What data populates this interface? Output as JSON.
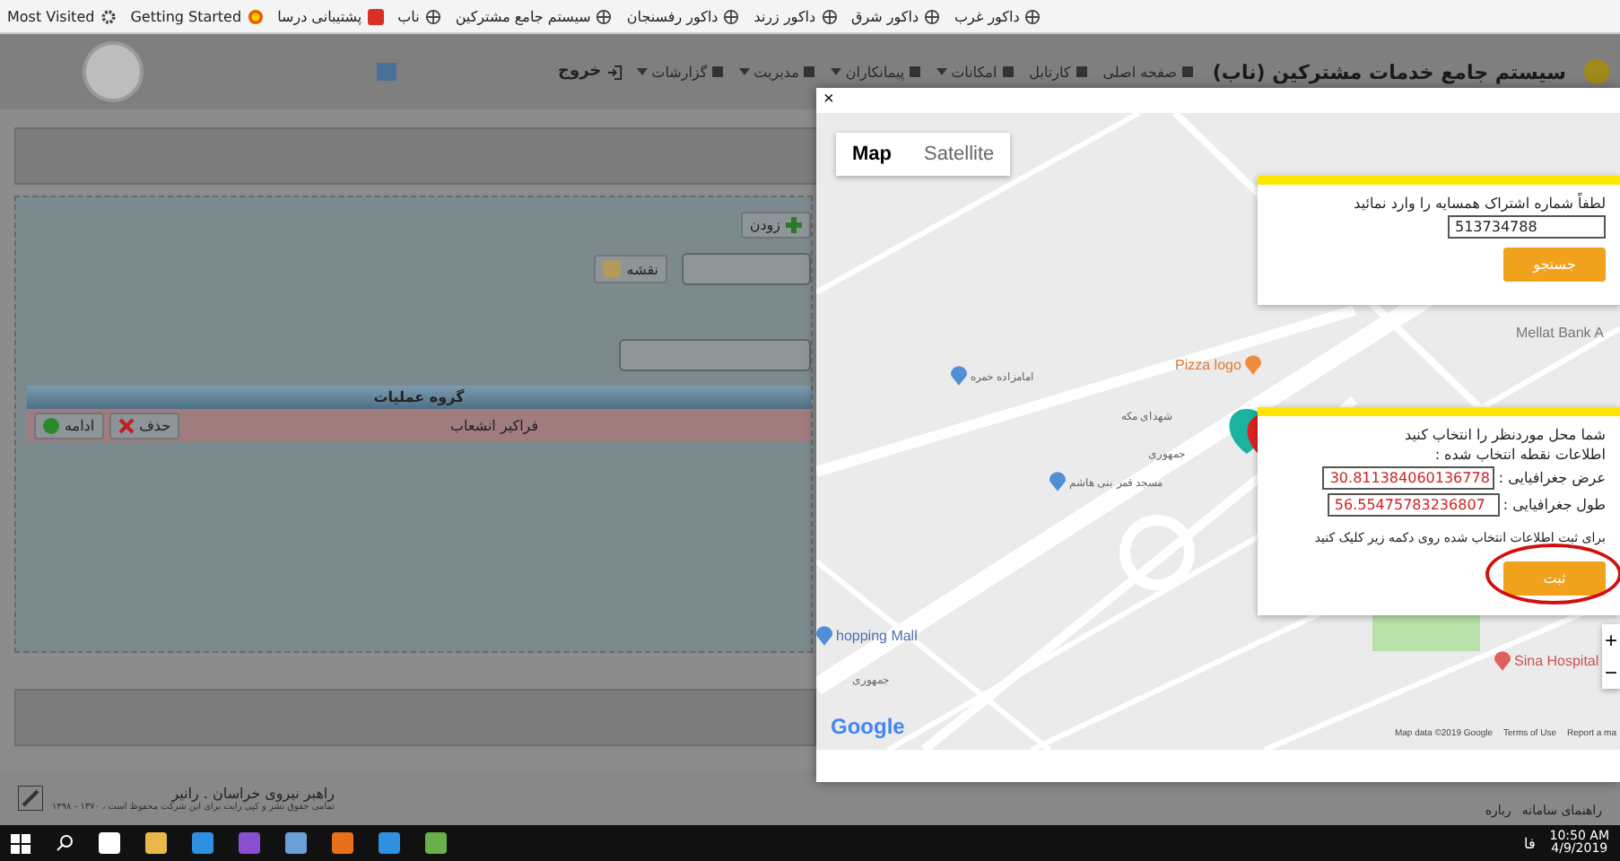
{
  "bookmarks": [
    {
      "label": "داکور غرب",
      "kind": "globe"
    },
    {
      "label": "داکور شرق",
      "kind": "globe"
    },
    {
      "label": "داکور زرند",
      "kind": "globe"
    },
    {
      "label": "داکور رفسنجان",
      "kind": "globe"
    },
    {
      "label": "سیستم جامع مشترکین",
      "kind": "globe"
    },
    {
      "label": "ناب",
      "kind": "globe"
    },
    {
      "label": "پشتیبانی درسا",
      "kind": "red"
    },
    {
      "label": "Getting Started",
      "kind": "firefox"
    },
    {
      "label": "Most Visited",
      "kind": "gear"
    }
  ],
  "header": {
    "title": "سیستم جامع خدمات مشترکین (ناب)",
    "nav": [
      {
        "label": "صفحه اصلی",
        "has_menu": false
      },
      {
        "label": "کارتابل",
        "has_menu": false
      },
      {
        "label": "امکانات",
        "has_menu": true
      },
      {
        "label": "پیمانکاران",
        "has_menu": true
      },
      {
        "label": "مدیریت",
        "has_menu": true
      },
      {
        "label": "گزارشات",
        "has_menu": true
      }
    ],
    "logout": "خروج"
  },
  "form": {
    "add_button": "زودن",
    "map_button": "نقشه",
    "table": {
      "columns": [
        "گروه عملیات"
      ],
      "rows": [
        {
          "cells": [
            "فراکیر انشعاب"
          ],
          "actions": [
            {
              "label": "حذف",
              "kind": "delete"
            },
            {
              "label": "ادامه",
              "kind": "continue"
            }
          ]
        }
      ]
    }
  },
  "footer": {
    "company": "راهبر نیروی خراسان . رانیر",
    "copyright": "تمامی حقوق نشر و کپی رایت برای این شرکت محفوظ است ، ۱۳۷۰ - ۱۳۹۸",
    "links": [
      "راهنمای سامانه",
      "رباره"
    ]
  },
  "modal": {
    "close": "×",
    "map_types": [
      {
        "label": "Satellite",
        "selected": false
      },
      {
        "label": "Map",
        "selected": true
      }
    ],
    "search_box": {
      "prompt": "لطفاً شماره اشتراک همسایه را وارد نمائید",
      "value": "513734788",
      "button": "جستجو"
    },
    "location_box": {
      "lines": [
        "شما محل موردنظر را انتخاب کنید",
        "اطلاعات نقطه انتخاب شده :"
      ],
      "fields": [
        {
          "label": "عرض جغرافیایی :",
          "value": "30.811384060136778"
        },
        {
          "label": "طول جغرافیایی :",
          "value": "56.55475783236807"
        }
      ],
      "hint": "برای ثبت اطلاعات انتخاب شده روی دکمه زیر کلیک کنید",
      "button": "ثبت",
      "button_circled": true
    },
    "map_labels": [
      {
        "text": "Pizza logo",
        "kind": "food"
      },
      {
        "text": "Mellat Bank A",
        "kind": "plain"
      },
      {
        "text": "امامزاده خمره",
        "kind": "worship"
      },
      {
        "text": "شهدای مکه",
        "kind": "street"
      },
      {
        "text": "جمهوری",
        "kind": "street"
      },
      {
        "text": "مسجد قمر بنی هاشم",
        "kind": "worship"
      },
      {
        "text": "hopping Mall",
        "kind": "shop"
      },
      {
        "text": "Sina Hospital",
        "kind": "hospital"
      },
      {
        "text": "جمهوری",
        "kind": "street"
      }
    ],
    "zoom": [
      "+",
      "−"
    ],
    "logo": "Google",
    "attribution": [
      "Report a ma",
      "Terms of Use",
      "Map data ©2019 Google"
    ]
  },
  "taskbar": {
    "lang": "فا",
    "time": "10:50 AM",
    "date": "4/9/2019"
  }
}
